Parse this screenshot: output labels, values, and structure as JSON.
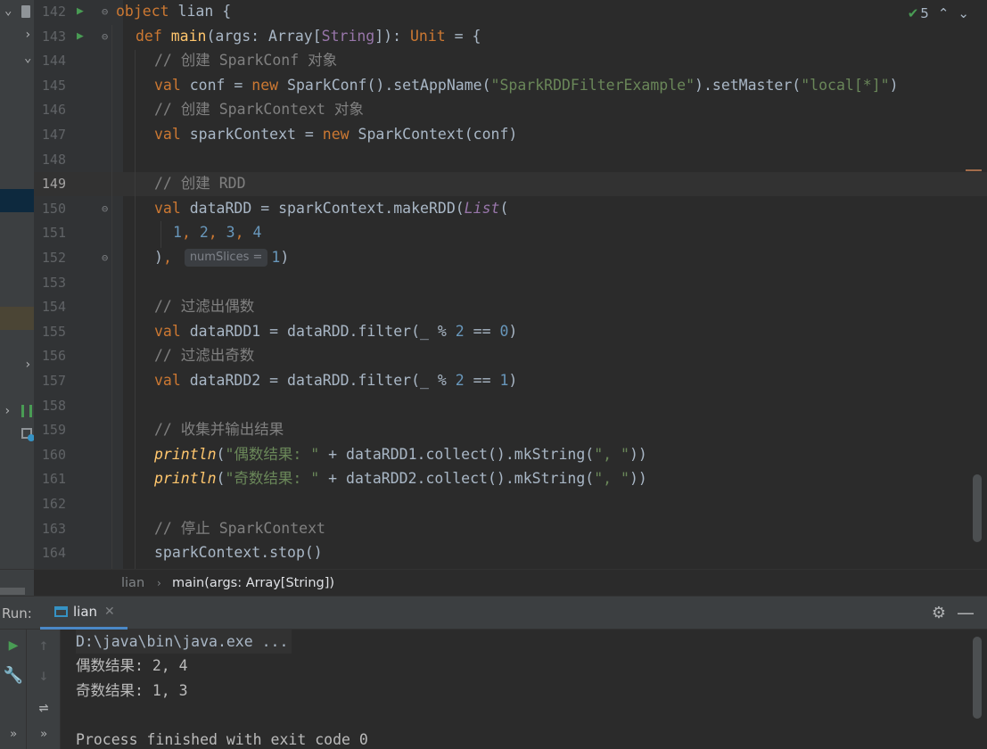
{
  "editor": {
    "inspection_count": "5",
    "lines": [
      {
        "n": "142",
        "run": true,
        "fold": "open",
        "indent": 0,
        "parts": [
          {
            "c": "kw",
            "t": "object "
          },
          {
            "c": "ty",
            "t": "lian {"
          }
        ]
      },
      {
        "n": "143",
        "run": true,
        "fold": "open",
        "indent": 1,
        "parts": [
          {
            "c": "kw",
            "t": "def "
          },
          {
            "c": "fn",
            "t": "main"
          },
          {
            "c": "ty",
            "t": "(args: Array["
          },
          {
            "c": "tyk",
            "t": "String"
          },
          {
            "c": "ty",
            "t": "]): "
          },
          {
            "c": "kw",
            "t": "Unit"
          },
          {
            "c": "ty",
            "t": " = {"
          }
        ]
      },
      {
        "n": "144",
        "indent": 2,
        "parts": [
          {
            "c": "cm",
            "t": "// 创建 SparkConf 对象"
          }
        ]
      },
      {
        "n": "145",
        "indent": 2,
        "parts": [
          {
            "c": "kw",
            "t": "val "
          },
          {
            "c": "ty",
            "t": "conf = "
          },
          {
            "c": "kw",
            "t": "new "
          },
          {
            "c": "ty",
            "t": "SparkConf().setAppName("
          },
          {
            "c": "str",
            "t": "\"SparkRDDFilterExample\""
          },
          {
            "c": "ty",
            "t": ").setMaster("
          },
          {
            "c": "str",
            "t": "\"local[*]\""
          },
          {
            "c": "ty",
            "t": ")"
          }
        ]
      },
      {
        "n": "146",
        "indent": 2,
        "parts": [
          {
            "c": "cm",
            "t": "// 创建 SparkContext 对象"
          }
        ]
      },
      {
        "n": "147",
        "indent": 2,
        "parts": [
          {
            "c": "kw",
            "t": "val "
          },
          {
            "c": "ty",
            "t": "sparkContext = "
          },
          {
            "c": "kw",
            "t": "new "
          },
          {
            "c": "ty",
            "t": "SparkContext(conf)"
          }
        ]
      },
      {
        "n": "148",
        "indent": 2,
        "parts": []
      },
      {
        "n": "149",
        "indent": 2,
        "active": true,
        "parts": [
          {
            "c": "cm",
            "t": "// 创建 RDD"
          }
        ]
      },
      {
        "n": "150",
        "fold": "open",
        "indent": 2,
        "parts": [
          {
            "c": "kw",
            "t": "val "
          },
          {
            "c": "ty",
            "t": "dataRDD = sparkContext.makeRDD("
          },
          {
            "c": "itp",
            "t": "List"
          },
          {
            "c": "ty",
            "t": "("
          }
        ]
      },
      {
        "n": "151",
        "indent": 3,
        "parts": [
          {
            "c": "num",
            "t": "1"
          },
          {
            "c": "kw",
            "t": ", "
          },
          {
            "c": "num",
            "t": "2"
          },
          {
            "c": "kw",
            "t": ", "
          },
          {
            "c": "num",
            "t": "3"
          },
          {
            "c": "kw",
            "t": ", "
          },
          {
            "c": "num",
            "t": "4"
          }
        ]
      },
      {
        "n": "152",
        "fold": "close",
        "indent": 2,
        "parts": [
          {
            "c": "ty",
            "t": ")"
          },
          {
            "c": "kw",
            "t": ", "
          },
          {
            "c": "hint",
            "t": "numSlices ="
          },
          {
            "c": "num",
            "t": "1"
          },
          {
            "c": "ty",
            "t": ")"
          }
        ]
      },
      {
        "n": "153",
        "indent": 2,
        "parts": []
      },
      {
        "n": "154",
        "indent": 2,
        "parts": [
          {
            "c": "cm",
            "t": "// 过滤出偶数"
          }
        ]
      },
      {
        "n": "155",
        "indent": 2,
        "parts": [
          {
            "c": "kw",
            "t": "val "
          },
          {
            "c": "ty",
            "t": "dataRDD1 = dataRDD.filter(_ % "
          },
          {
            "c": "num",
            "t": "2"
          },
          {
            "c": "ty",
            "t": " == "
          },
          {
            "c": "num",
            "t": "0"
          },
          {
            "c": "ty",
            "t": ")"
          }
        ]
      },
      {
        "n": "156",
        "indent": 2,
        "parts": [
          {
            "c": "cm",
            "t": "// 过滤出奇数"
          }
        ]
      },
      {
        "n": "157",
        "indent": 2,
        "parts": [
          {
            "c": "kw",
            "t": "val "
          },
          {
            "c": "ty",
            "t": "dataRDD2 = dataRDD.filter(_ % "
          },
          {
            "c": "num",
            "t": "2"
          },
          {
            "c": "ty",
            "t": " == "
          },
          {
            "c": "num",
            "t": "1"
          },
          {
            "c": "ty",
            "t": ")"
          }
        ]
      },
      {
        "n": "158",
        "indent": 2,
        "parts": []
      },
      {
        "n": "159",
        "indent": 2,
        "parts": [
          {
            "c": "cm",
            "t": "// 收集并输出结果"
          }
        ]
      },
      {
        "n": "160",
        "indent": 2,
        "parts": [
          {
            "c": "it",
            "t": "println"
          },
          {
            "c": "ty",
            "t": "("
          },
          {
            "c": "str",
            "t": "\"偶数结果: \""
          },
          {
            "c": "ty",
            "t": " + dataRDD1.collect().mkString("
          },
          {
            "c": "str",
            "t": "\", \""
          },
          {
            "c": "ty",
            "t": "))"
          }
        ]
      },
      {
        "n": "161",
        "indent": 2,
        "parts": [
          {
            "c": "it",
            "t": "println"
          },
          {
            "c": "ty",
            "t": "("
          },
          {
            "c": "str",
            "t": "\"奇数结果: \""
          },
          {
            "c": "ty",
            "t": " + dataRDD2.collect().mkString("
          },
          {
            "c": "str",
            "t": "\", \""
          },
          {
            "c": "ty",
            "t": "))"
          }
        ]
      },
      {
        "n": "162",
        "indent": 2,
        "parts": []
      },
      {
        "n": "163",
        "indent": 2,
        "parts": [
          {
            "c": "cm",
            "t": "// 停止 SparkContext"
          }
        ]
      },
      {
        "n": "164",
        "indent": 2,
        "parts": [
          {
            "c": "ty",
            "t": "sparkContext.stop()"
          }
        ]
      }
    ]
  },
  "breadcrumb": {
    "object": "lian",
    "method": "main(args: Array[String])"
  },
  "run": {
    "label": "Run:",
    "tab": "lian",
    "console": [
      {
        "text": "D:\\java\\bin\\java.exe ...",
        "kind": "cmd"
      },
      {
        "text": "偶数结果: 2, 4",
        "kind": "out"
      },
      {
        "text": "奇数结果: 1, 3",
        "kind": "out"
      },
      {
        "text": "",
        "kind": "out"
      },
      {
        "text": "Process finished with exit code 0",
        "kind": "done"
      }
    ]
  },
  "colors": {
    "background": "#2b2b2b",
    "keyword": "#cc7832",
    "string": "#6a8759",
    "number": "#6897bb",
    "comment": "#808080",
    "function": "#ffc66d",
    "run_green": "#499c54",
    "tab_accent": "#4a88c7"
  }
}
